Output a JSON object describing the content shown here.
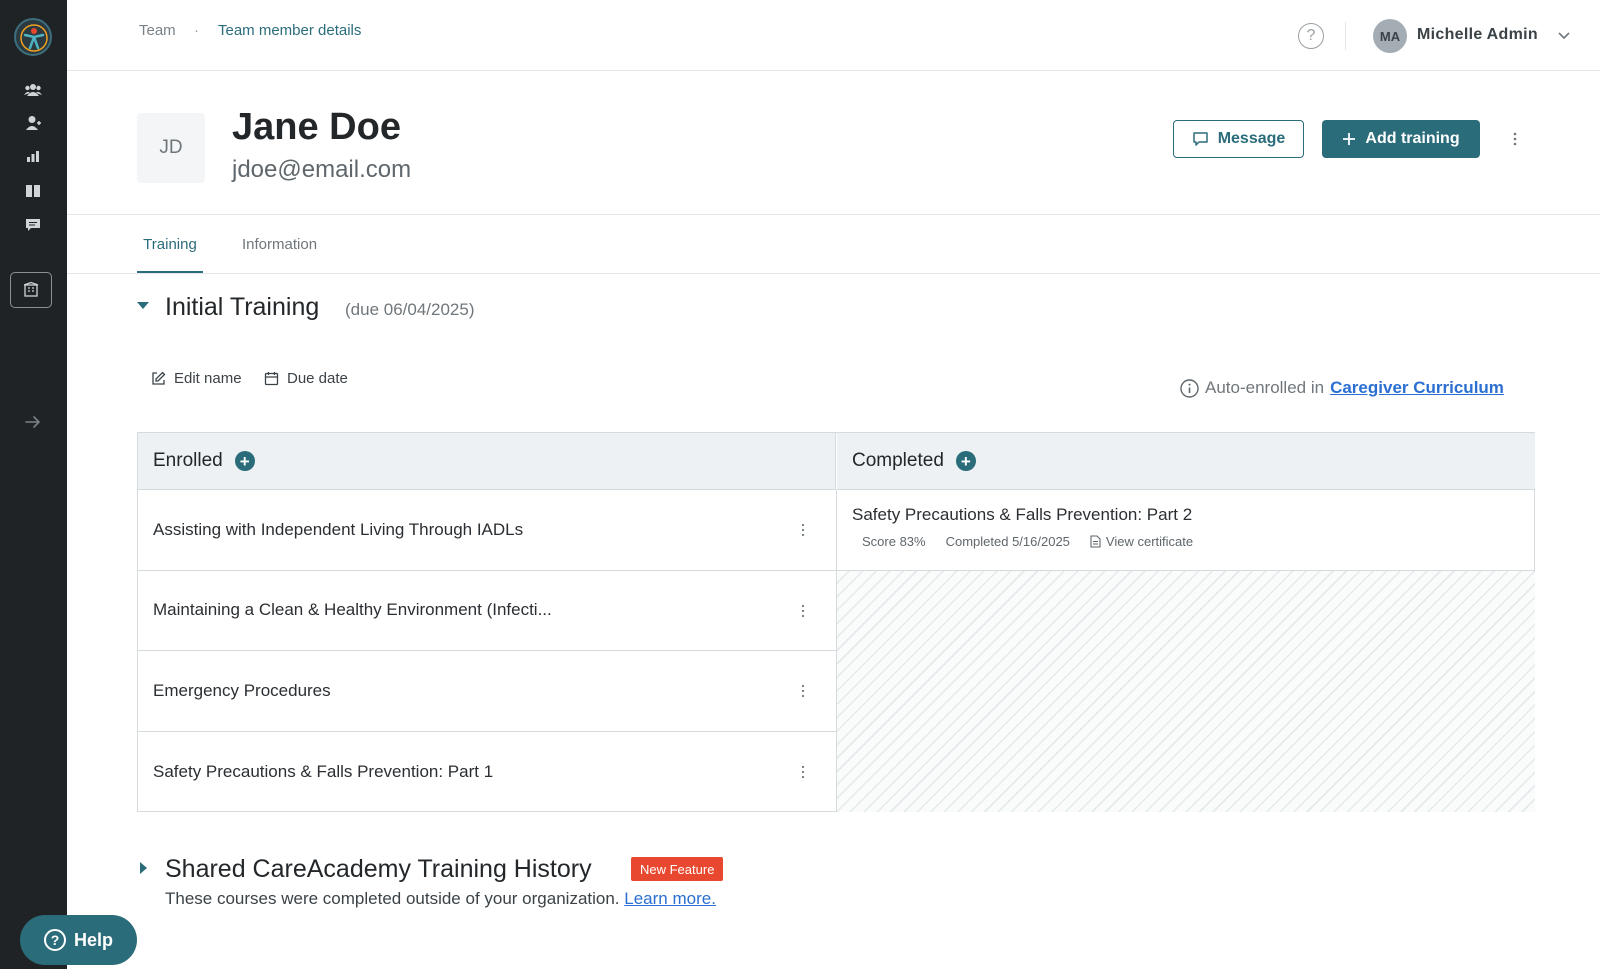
{
  "breadcrumb": {
    "root": "Team",
    "separator": "·",
    "current": "Team member details"
  },
  "user": {
    "initials": "MA",
    "name": "Michelle Admin"
  },
  "profile": {
    "initials": "JD",
    "name": "Jane Doe",
    "email": "jdoe@email.com"
  },
  "actions": {
    "message": "Message",
    "add_training": "Add training"
  },
  "tabs": {
    "training": "Training",
    "information": "Information"
  },
  "section": {
    "title": "Initial Training",
    "due": "(due 06/04/2025)",
    "edit_name": "Edit name",
    "due_date": "Due date",
    "auto_enrolled_prefix": "Auto-enrolled in",
    "curriculum_link": "Caregiver Curriculum"
  },
  "board": {
    "enrolled_label": "Enrolled",
    "completed_label": "Completed",
    "enrolled": [
      {
        "title": "Assisting with Independent Living Through IADLs"
      },
      {
        "title": "Maintaining a Clean & Healthy Environment (Infecti..."
      },
      {
        "title": "Emergency Procedures"
      },
      {
        "title": "Safety Precautions & Falls Prevention: Part 1"
      }
    ],
    "completed": [
      {
        "title": "Safety Precautions & Falls Prevention: Part 2",
        "score": "Score 83%",
        "date": "Completed 5/16/2025",
        "certificate": "View certificate"
      }
    ]
  },
  "shared": {
    "title": "Shared CareAcademy Training History",
    "badge": "New Feature",
    "description": "These courses were completed outside of your organization.",
    "link": "Learn more."
  },
  "help": {
    "label": "Help"
  },
  "colors": {
    "accent": "#2b6c7b",
    "sidebar": "#1f2326",
    "link": "#2a6fd1",
    "badge": "#e8482f"
  }
}
